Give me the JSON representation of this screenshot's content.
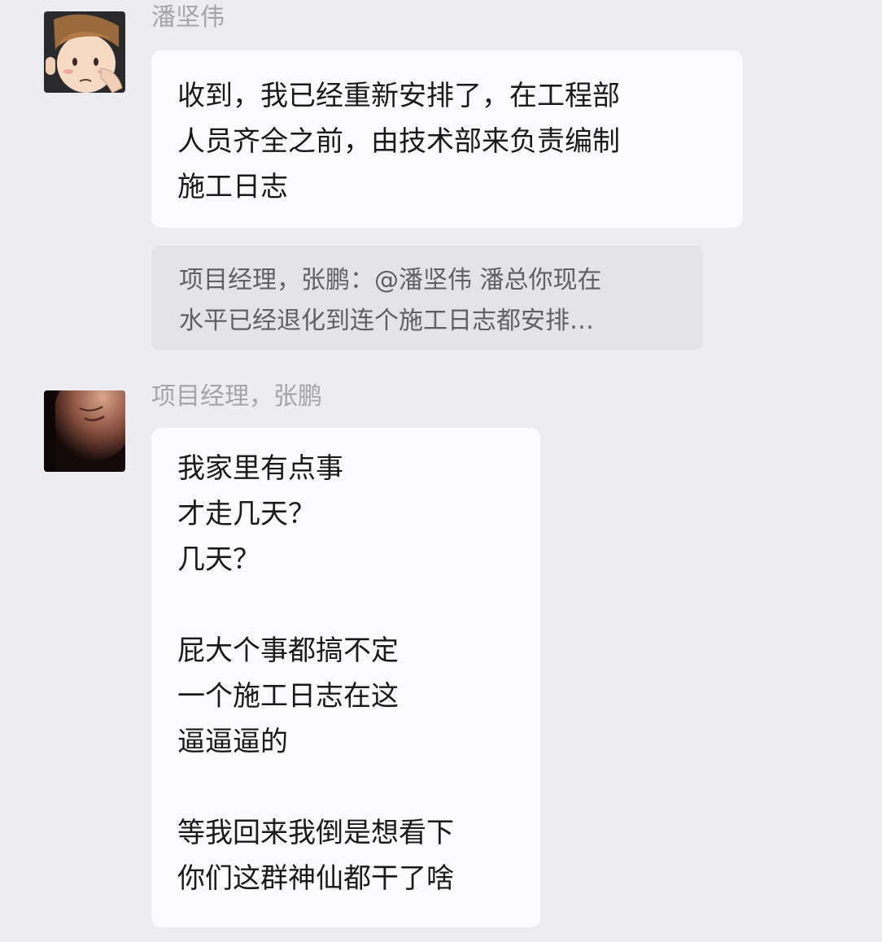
{
  "messages": [
    {
      "sender": "潘坚伟",
      "avatar": "avatar-cartoon-face",
      "lines": [
        "收到，我已经重新安排了，在工程部",
        "人员齐全之前，由技术部来负责编制",
        "施工日志"
      ]
    },
    {
      "sender": "项目经理，张鹏",
      "avatar": "avatar-photo",
      "lines": [
        "我家里有点事",
        "才走几天？",
        "几天？",
        "",
        "屁大个事都搞不定",
        "一个施工日志在这",
        "逼逼逼的",
        "",
        "等我回来我倒是想看下",
        "你们这群神仙都干了啥"
      ]
    }
  ],
  "quote": {
    "lines": [
      "项目经理，张鹏：@潘坚伟 潘总你现在",
      "水平已经退化到连个施工日志都安排…"
    ]
  },
  "colors": {
    "background": "#ededf1",
    "bubble": "#fbfbfd",
    "quote_bg": "#e4e4e8",
    "sender_text": "#a4a4aa"
  }
}
